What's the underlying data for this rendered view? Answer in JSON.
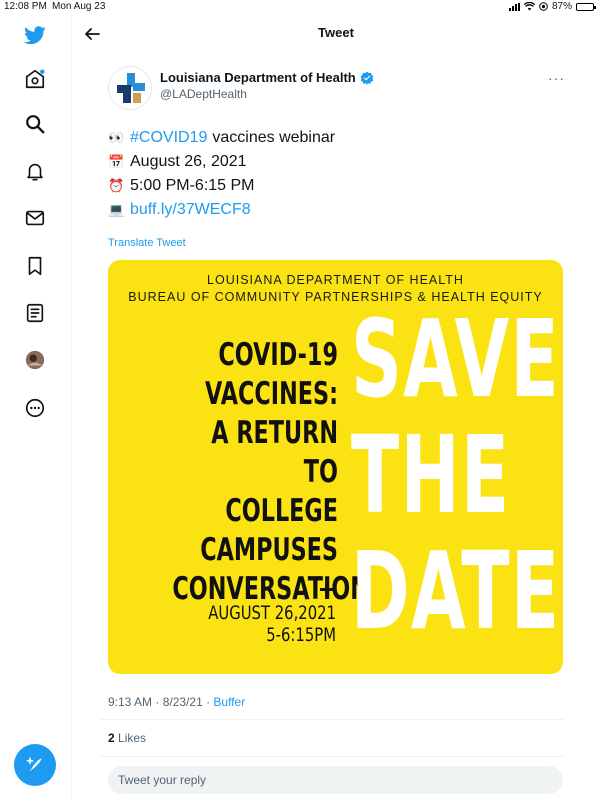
{
  "status_bar": {
    "time": "12:08 PM",
    "date": "Mon Aug 23",
    "battery": "87%",
    "battery_level": 0.87
  },
  "sidebar": {
    "items": [
      "twitter-logo-icon",
      "home-icon",
      "search-icon",
      "notifications-icon",
      "messages-icon",
      "bookmarks-icon",
      "lists-icon",
      "profile-avatar",
      "more-icon"
    ],
    "compose": "compose-tweet-icon"
  },
  "header": {
    "title": "Tweet"
  },
  "author": {
    "name": "Louisiana Department of Health",
    "handle": "@LADeptHealth",
    "verified": true,
    "more": "···"
  },
  "tweet": {
    "line1": {
      "emoji": "👀",
      "hashtag": "#COVID19",
      "text": "vaccines webinar"
    },
    "line2": {
      "emoji": "📅",
      "text": "August 26, 2021"
    },
    "line3": {
      "emoji": "⏰",
      "text": "5:00 PM-6:15 PM"
    },
    "line4": {
      "emoji": "💻",
      "link": "buff.ly/37WECF8"
    },
    "translate": "Translate Tweet"
  },
  "image": {
    "org_line1": "LOUISIANA DEPARTMENT OF HEALTH",
    "org_line2": "BUREAU OF COMMUNITY PARTNERSHIPS & HEALTH EQUITY",
    "title_lines": [
      "COVID-19",
      "VACCINES:",
      "A RETURN TO",
      "COLLEGE",
      "CAMPUSES",
      "CONVERSATION"
    ],
    "date_line1": "AUGUST 26,2021",
    "date_line2": "5-6:15PM",
    "save_lines": [
      "SAVE",
      "THE",
      "DATE"
    ],
    "background_color": "#fbe212"
  },
  "meta": {
    "time": "9:13 AM",
    "separator": " · ",
    "date": "8/23/21",
    "source": "Buffer"
  },
  "likes": {
    "count": "2",
    "label": "Likes"
  },
  "reply": {
    "placeholder": "Tweet your reply"
  },
  "colors": {
    "accent": "#1d9bf0",
    "text": "#0f1419",
    "secondary": "#536471"
  }
}
